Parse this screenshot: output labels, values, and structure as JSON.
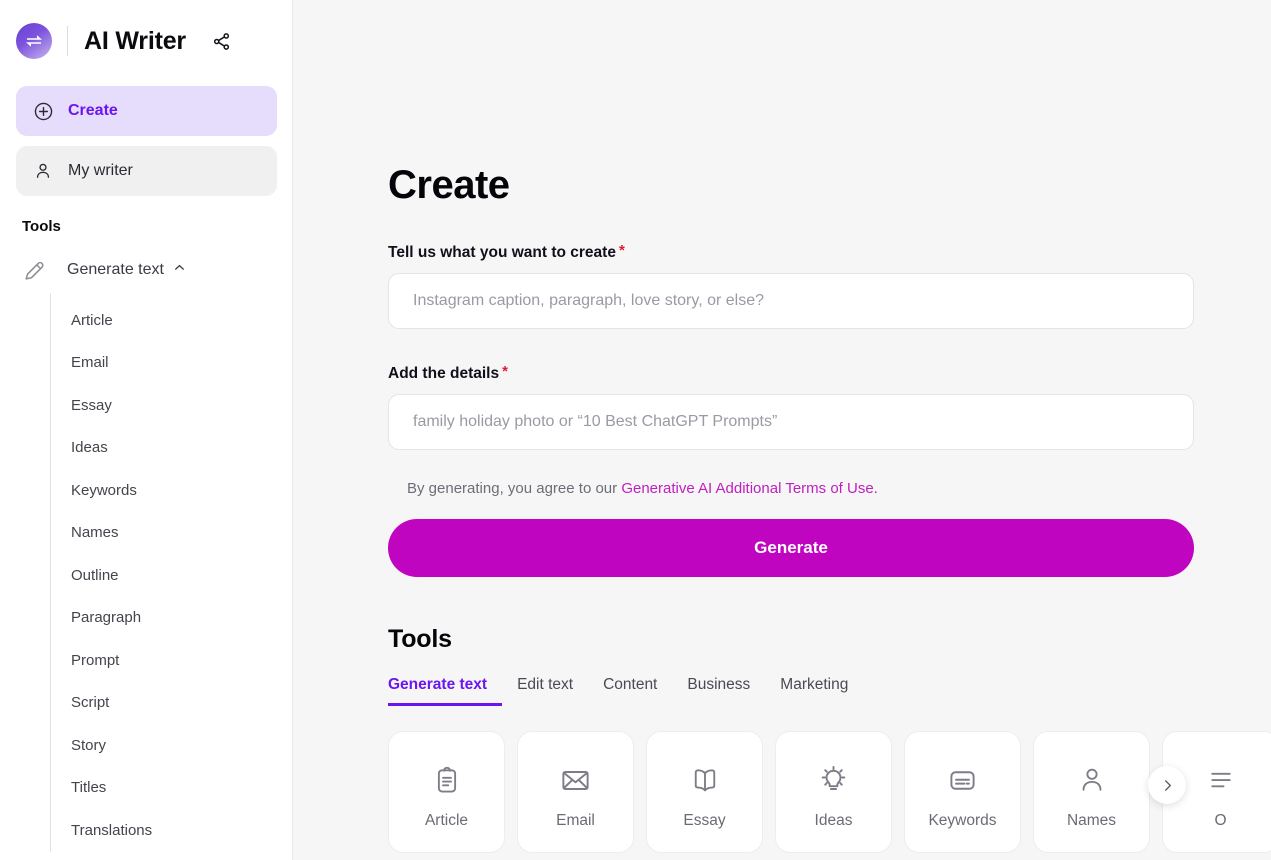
{
  "brand": {
    "title": "AI Writer",
    "logo_icon": "swap-arrows-logo-icon",
    "share_icon": "share-icon",
    "accent_purple": "#6b16f0",
    "accent_magenta": "#c005c0"
  },
  "sidebar": {
    "nav": [
      {
        "label": "Create",
        "icon": "plus-circle-icon",
        "active": true
      },
      {
        "label": "My writer",
        "icon": "person-icon",
        "active": false
      }
    ],
    "tools_heading": "Tools",
    "group": {
      "label": "Generate text",
      "icon": "pencil-icon",
      "chevron": "chevron-up-icon",
      "expanded": true,
      "items": [
        "Article",
        "Email",
        "Essay",
        "Ideas",
        "Keywords",
        "Names",
        "Outline",
        "Paragraph",
        "Prompt",
        "Script",
        "Story",
        "Titles",
        "Translations"
      ]
    }
  },
  "main": {
    "page_title": "Create",
    "fields": [
      {
        "label": "Tell us what you want to create",
        "required_mark": "*",
        "value": "",
        "placeholder": "Instagram caption, paragraph, love story, or else?"
      },
      {
        "label": "Add the details",
        "required_mark": "*",
        "value": "",
        "placeholder": "family holiday photo or “10 Best ChatGPT Prompts”"
      }
    ],
    "terms": {
      "prefix": "By generating, you agree to our ",
      "link": "Generative AI Additional Terms of Use."
    },
    "generate_label": "Generate",
    "tools_section": {
      "title": "Tools",
      "tabs": [
        {
          "label": "Generate text",
          "active": true
        },
        {
          "label": "Edit text",
          "active": false
        },
        {
          "label": "Content",
          "active": false
        },
        {
          "label": "Business",
          "active": false
        },
        {
          "label": "Marketing",
          "active": false
        }
      ],
      "cards": [
        {
          "label": "Article",
          "icon": "clipboard-icon"
        },
        {
          "label": "Email",
          "icon": "envelope-icon"
        },
        {
          "label": "Essay",
          "icon": "open-book-icon"
        },
        {
          "label": "Ideas",
          "icon": "lightbulb-icon"
        },
        {
          "label": "Keywords",
          "icon": "keyword-card-icon"
        },
        {
          "label": "Names",
          "icon": "person-icon"
        },
        {
          "label": "O",
          "icon": "outline-icon"
        }
      ],
      "next_icon": "chevron-right-icon"
    }
  }
}
